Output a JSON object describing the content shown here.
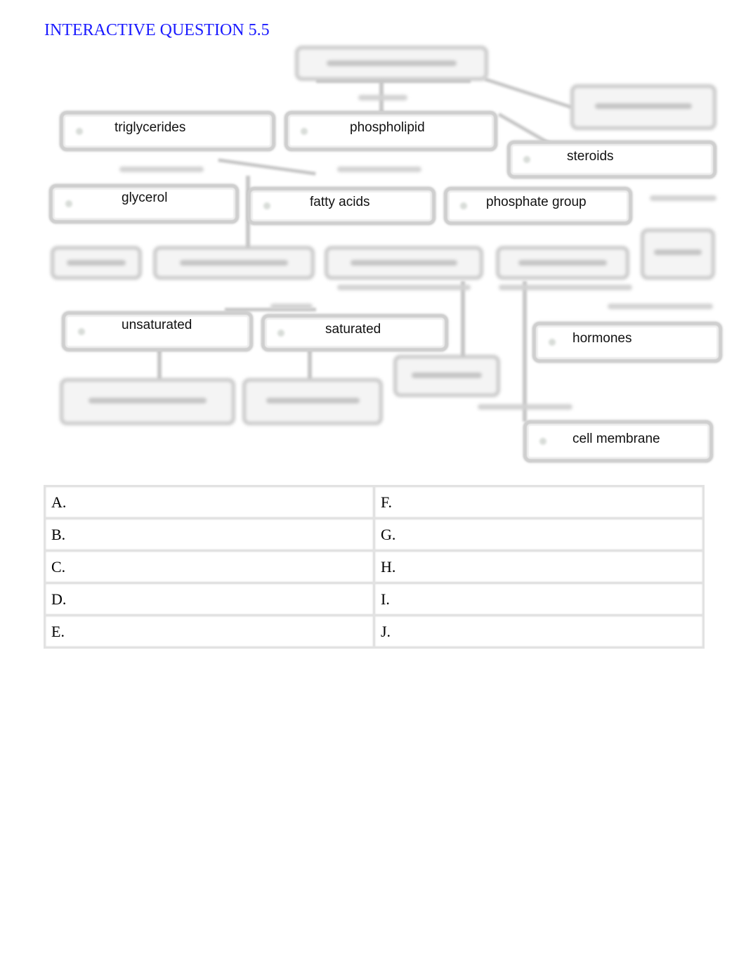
{
  "title": "INTERACTIVE QUESTION 5.5",
  "diagram": {
    "visible_labels": {
      "triglycerides": "triglycerides",
      "phospholipid": "phospholipid",
      "steroids": "steroids",
      "glycerol": "glycerol",
      "fatty_acids": "fatty acids",
      "phosphate_group": "phosphate group",
      "unsaturated": "unsaturated",
      "saturated": "saturated",
      "hormones": "hormones",
      "cell_membrane": "cell membrane"
    }
  },
  "answers": {
    "left": [
      "A.",
      "B.",
      "C.",
      "D.",
      "E."
    ],
    "right": [
      "F.",
      "G.",
      "H.",
      "I.",
      "J."
    ]
  }
}
